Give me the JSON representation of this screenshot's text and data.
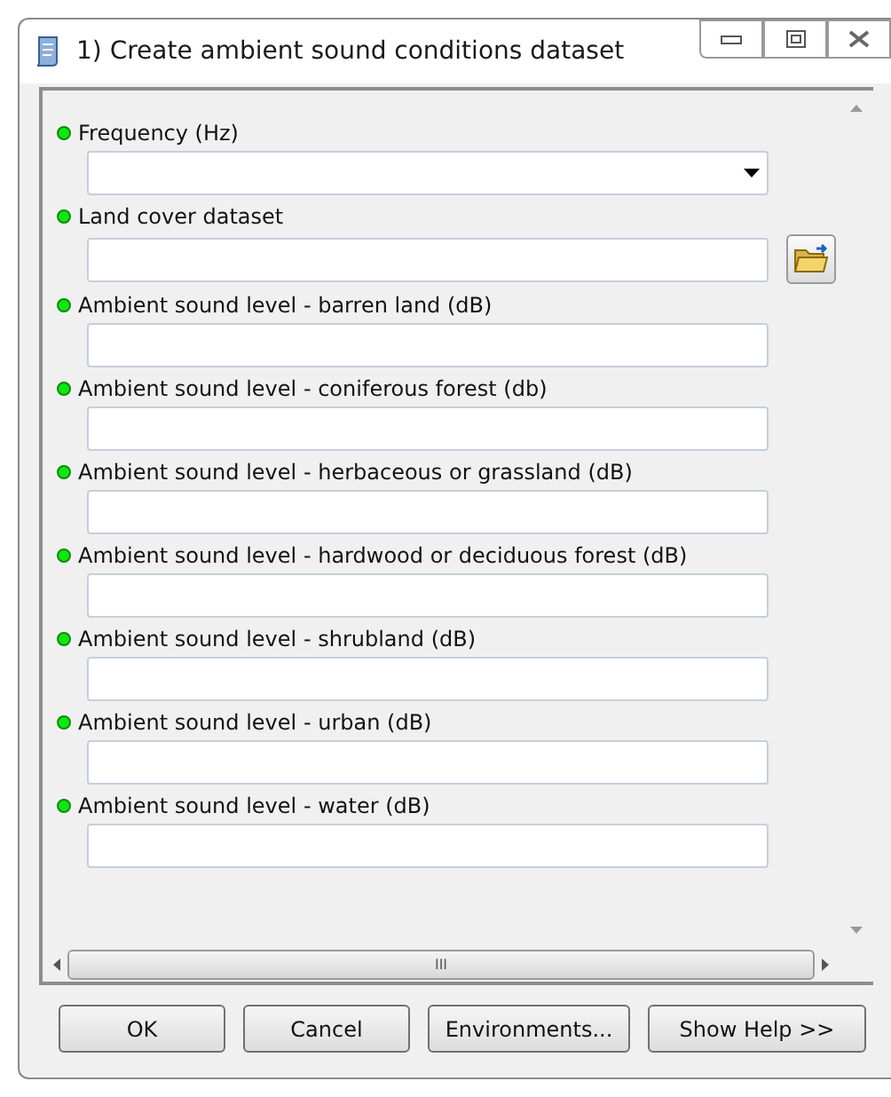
{
  "window": {
    "title": "1) Create ambient sound conditions dataset"
  },
  "parameters": [
    {
      "label": "Frequency (Hz)",
      "kind": "dropdown",
      "required": true
    },
    {
      "label": "Land cover dataset",
      "kind": "browse",
      "required": true
    },
    {
      "label": "Ambient sound level - barren land (dB)",
      "kind": "text",
      "required": true
    },
    {
      "label": "Ambient sound level - coniferous forest (db)",
      "kind": "text",
      "required": true
    },
    {
      "label": "Ambient sound level - herbaceous or grassland (dB)",
      "kind": "text",
      "required": true
    },
    {
      "label": "Ambient sound level - hardwood or deciduous forest (dB)",
      "kind": "text",
      "required": true
    },
    {
      "label": "Ambient sound level - shrubland (dB)",
      "kind": "text",
      "required": true
    },
    {
      "label": "Ambient sound level - urban (dB)",
      "kind": "text",
      "required": true
    },
    {
      "label": "Ambient sound level - water (dB)",
      "kind": "text",
      "required": true
    }
  ],
  "scrollbar_grip": "III",
  "buttons": [
    "OK",
    "Cancel",
    "Environments...",
    "Show Help >>"
  ]
}
